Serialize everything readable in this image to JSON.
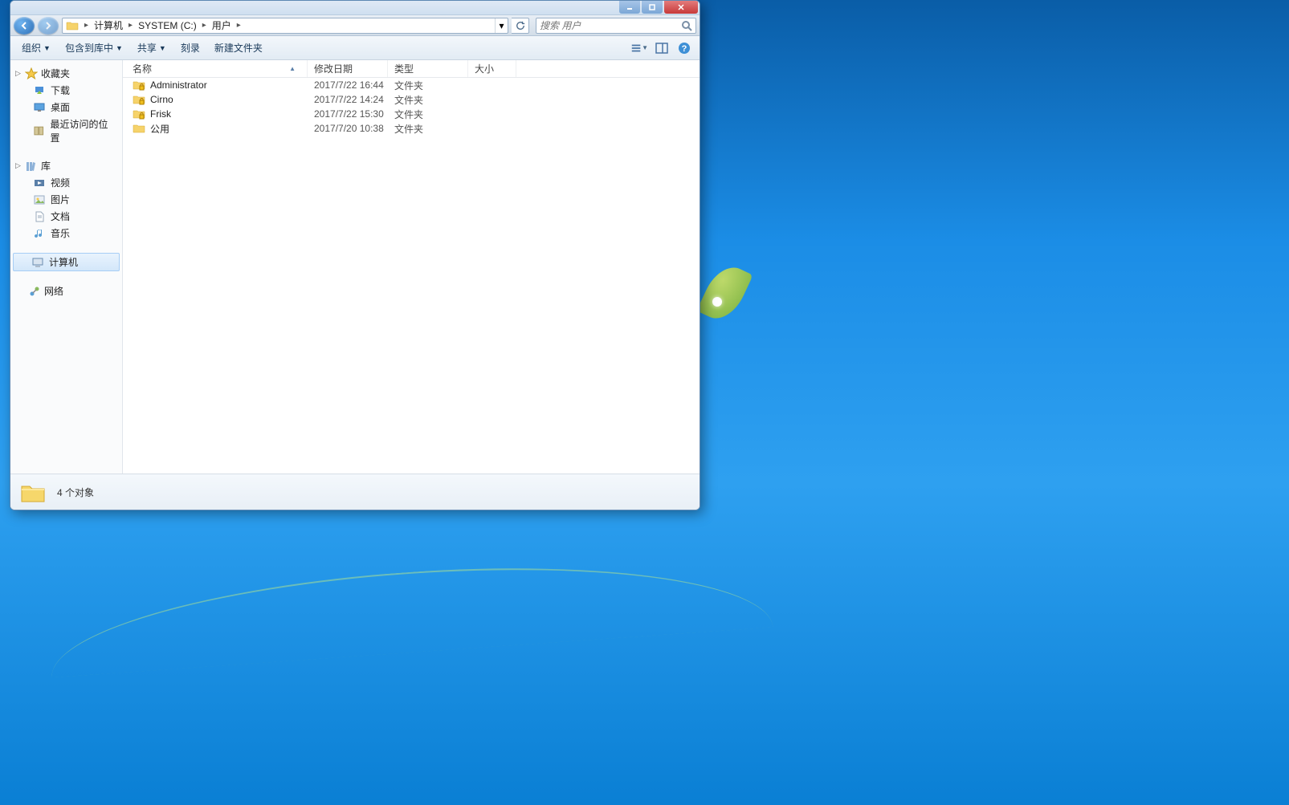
{
  "breadcrumb": {
    "root": "计算机",
    "drive": "SYSTEM (C:)",
    "folder": "用户"
  },
  "search": {
    "placeholder": "搜索 用户"
  },
  "toolbar": {
    "organize": "组织",
    "include": "包含到库中",
    "share": "共享",
    "burn": "刻录",
    "newfolder": "新建文件夹"
  },
  "columns": {
    "name": "名称",
    "date": "修改日期",
    "type": "类型",
    "size": "大小"
  },
  "sidebar": {
    "favorites": {
      "label": "收藏夹",
      "items": [
        "下载",
        "桌面",
        "最近访问的位置"
      ]
    },
    "libraries": {
      "label": "库",
      "items": [
        "视频",
        "图片",
        "文档",
        "音乐"
      ]
    },
    "computer": {
      "label": "计算机"
    },
    "network": {
      "label": "网络"
    }
  },
  "files": [
    {
      "name": "Administrator",
      "date": "2017/7/22 16:44",
      "type": "文件夹",
      "locked": true
    },
    {
      "name": "Cirno",
      "date": "2017/7/22 14:24",
      "type": "文件夹",
      "locked": true
    },
    {
      "name": "Frisk",
      "date": "2017/7/22 15:30",
      "type": "文件夹",
      "locked": true
    },
    {
      "name": "公用",
      "date": "2017/7/20 10:38",
      "type": "文件夹",
      "locked": false
    }
  ],
  "status": {
    "text": "4 个对象"
  }
}
